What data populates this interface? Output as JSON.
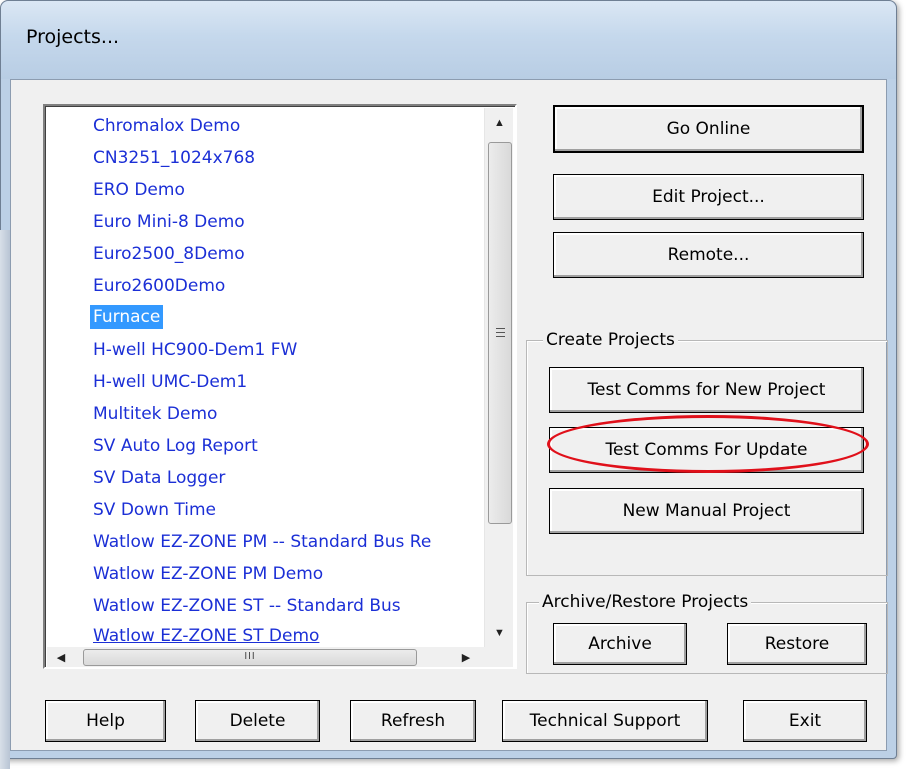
{
  "window": {
    "title": "Projects..."
  },
  "projects": {
    "items": [
      "Chromalox Demo",
      "CN3251_1024x768",
      "ERO Demo",
      "Euro Mini-8 Demo",
      "Euro2500_8Demo",
      "Euro2600Demo",
      "Furnace",
      "H-well HC900-Dem1 FW",
      "H-well UMC-Dem1",
      "Multitek Demo",
      "SV Auto Log Report",
      "SV Data Logger",
      "SV Down Time",
      "Watlow EZ-ZONE PM -- Standard Bus Re",
      "Watlow EZ-ZONE PM Demo",
      "Watlow EZ-ZONE ST -- Standard Bus",
      "Watlow EZ-ZONE ST Demo"
    ],
    "selected": "Furnace",
    "hscroll_thumb_label": "III"
  },
  "buttons": {
    "go_online": "Go Online",
    "edit_project": "Edit Project...",
    "remote": "Remote..."
  },
  "create_projects": {
    "label": "Create Projects",
    "test_comms_new": "Test Comms for New Project",
    "test_comms_update": "Test Comms For Update",
    "new_manual": "New Manual Project"
  },
  "archive_restore": {
    "label": "Archive/Restore Projects",
    "archive": "Archive",
    "restore": "Restore"
  },
  "footer": {
    "help": "Help",
    "delete": "Delete",
    "refresh": "Refresh",
    "technical_support": "Technical Support",
    "exit": "Exit"
  },
  "colors": {
    "list_text": "#1b2fd6",
    "selection": "#3399ff",
    "annotation": "#e0101a"
  }
}
